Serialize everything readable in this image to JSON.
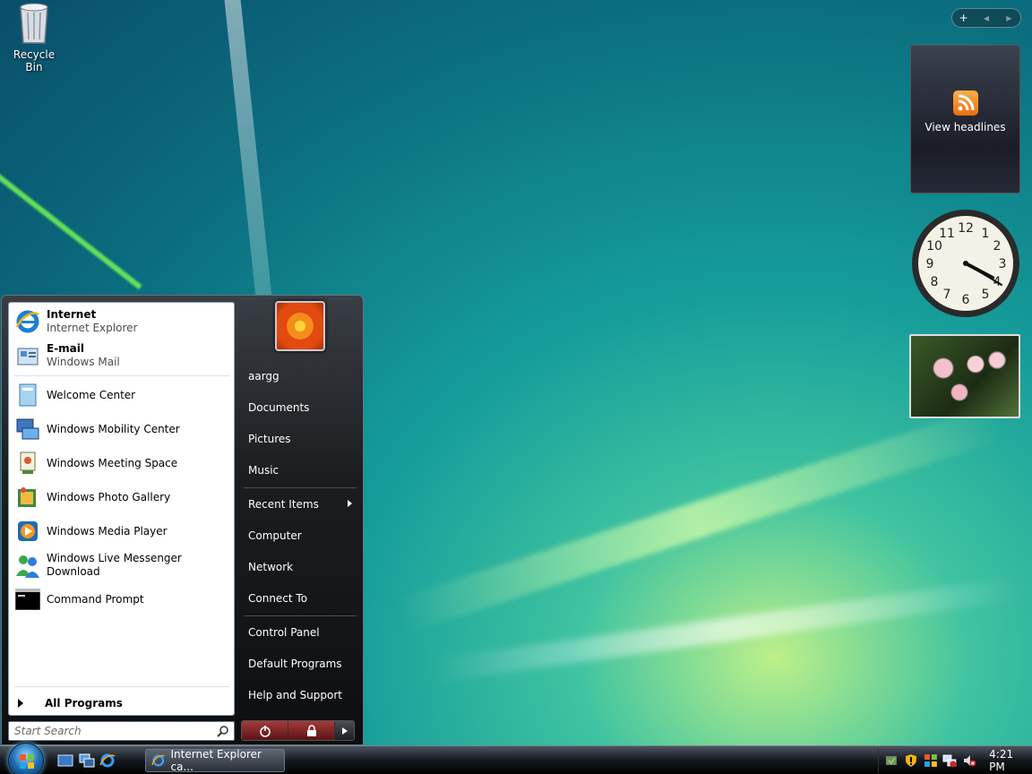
{
  "desktop": {
    "recycle_bin_label": "Recycle Bin"
  },
  "sidebar": {
    "controls": {
      "add": "+",
      "prev": "◂",
      "next": "▸"
    },
    "feed_gadget_label": "View headlines",
    "clock_numbers": [
      "12",
      "1",
      "2",
      "3",
      "4",
      "5",
      "6",
      "7",
      "8",
      "9",
      "10",
      "11"
    ]
  },
  "start_menu": {
    "pinned": [
      {
        "title": "Internet",
        "subtitle": "Internet Explorer",
        "icon": "ie-icon"
      },
      {
        "title": "E-mail",
        "subtitle": "Windows Mail",
        "icon": "mail-icon"
      }
    ],
    "recent": [
      {
        "label": "Welcome Center",
        "icon": "welcome-center-icon"
      },
      {
        "label": "Windows Mobility Center",
        "icon": "mobility-center-icon"
      },
      {
        "label": "Windows Meeting Space",
        "icon": "meeting-space-icon"
      },
      {
        "label": "Windows Photo Gallery",
        "icon": "photo-gallery-icon"
      },
      {
        "label": "Windows Media Player",
        "icon": "media-player-icon"
      },
      {
        "label": "Windows Live Messenger Download",
        "icon": "messenger-icon"
      },
      {
        "label": "Command Prompt",
        "icon": "command-prompt-icon"
      }
    ],
    "all_programs": "All Programs",
    "search_placeholder": "Start Search",
    "right_items": [
      {
        "label": "aargg"
      },
      {
        "label": "Documents"
      },
      {
        "label": "Pictures"
      },
      {
        "label": "Music"
      },
      {
        "label": "Recent Items"
      },
      {
        "label": "Computer"
      },
      {
        "label": "Network"
      },
      {
        "label": "Connect To"
      },
      {
        "label": "Control Panel"
      },
      {
        "label": "Default Programs"
      },
      {
        "label": "Help and Support"
      }
    ]
  },
  "taskbar": {
    "task_button_label": "Internet Explorer ca...",
    "clock": "4:21 PM"
  }
}
